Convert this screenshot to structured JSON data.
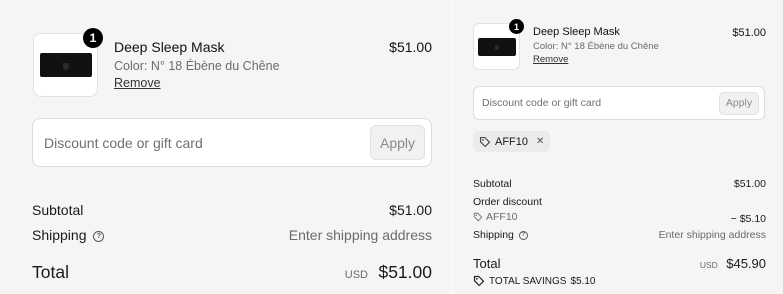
{
  "left": {
    "product": {
      "quantity": "1",
      "name": "Deep Sleep Mask",
      "color": "Color: N° 18 Ébène du Chêne",
      "remove_label": "Remove",
      "price": "$51.00"
    },
    "discount": {
      "placeholder": "Discount code or gift card",
      "apply_label": "Apply"
    },
    "summary": {
      "subtotal_label": "Subtotal",
      "subtotal_value": "$51.00",
      "shipping_label": "Shipping",
      "shipping_value": "Enter shipping address",
      "total_label": "Total",
      "currency": "USD",
      "total_value": "$51.00"
    }
  },
  "right": {
    "product": {
      "quantity": "1",
      "name": "Deep Sleep Mask",
      "color": "Color: N° 18 Ébène du Chêne",
      "remove_label": "Remove",
      "price": "$51.00"
    },
    "discount": {
      "placeholder": "Discount code or gift card",
      "apply_label": "Apply"
    },
    "applied_code": "AFF10",
    "summary": {
      "subtotal_label": "Subtotal",
      "subtotal_value": "$51.00",
      "order_discount_label": "Order discount",
      "discount_code": "AFF10",
      "discount_value": "− $5.10",
      "shipping_label": "Shipping",
      "shipping_value": "Enter shipping address",
      "total_label": "Total",
      "currency": "USD",
      "total_value": "$45.90",
      "savings_label": "TOTAL SAVINGS",
      "savings_value": "$5.10"
    }
  },
  "icons": {
    "help": "?",
    "remove_code": "✕"
  }
}
